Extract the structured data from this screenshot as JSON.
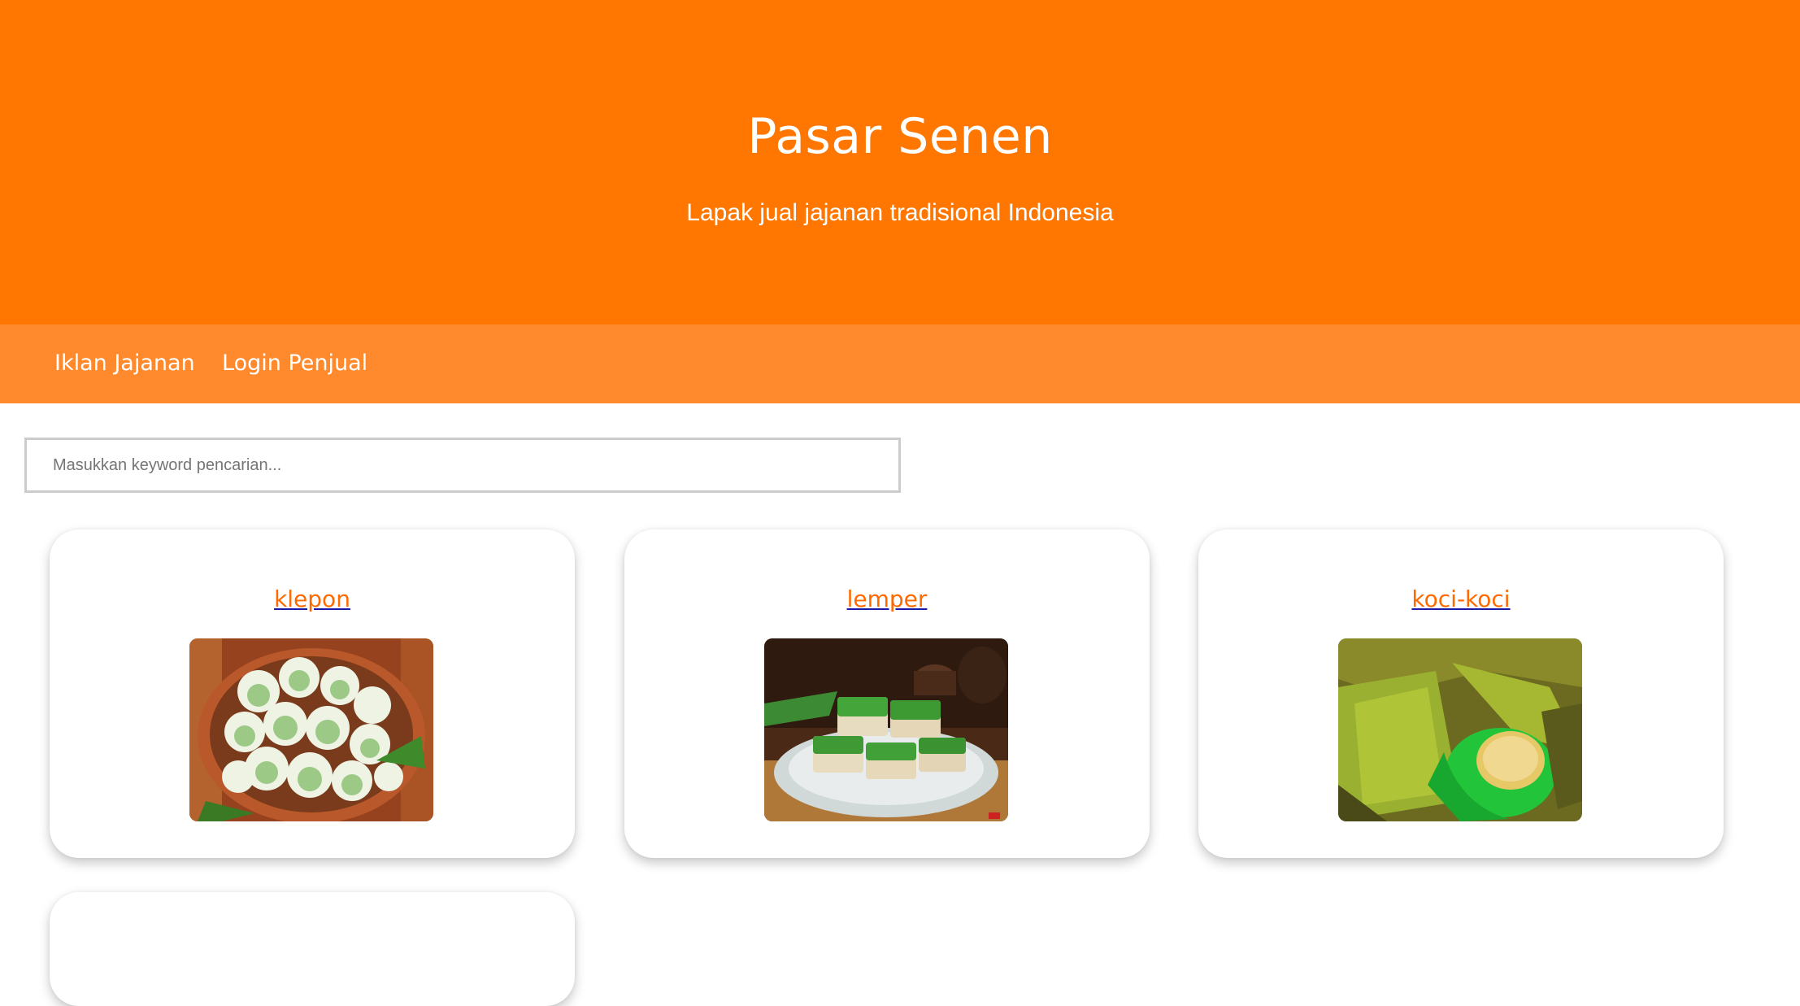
{
  "header": {
    "title": "Pasar Senen",
    "subtitle": "Lapak jual jajanan tradisional Indonesia",
    "background_color": "#ff7600"
  },
  "navbar": {
    "background_color": "#ff8a2e",
    "items": [
      {
        "label": "Iklan Jajanan"
      },
      {
        "label": "Login Penjual"
      }
    ]
  },
  "search": {
    "placeholder": "Masukkan keyword pencarian...",
    "value": ""
  },
  "products": [
    {
      "name": "klepon",
      "image": "klepon-photo"
    },
    {
      "name": "lemper",
      "image": "lemper-photo"
    },
    {
      "name": "koci-koci",
      "image": "koci-koci-photo"
    },
    {
      "name": "",
      "image": ""
    }
  ],
  "colors": {
    "accent": "#ff6a00",
    "link_underline": "#1a1aa6"
  }
}
